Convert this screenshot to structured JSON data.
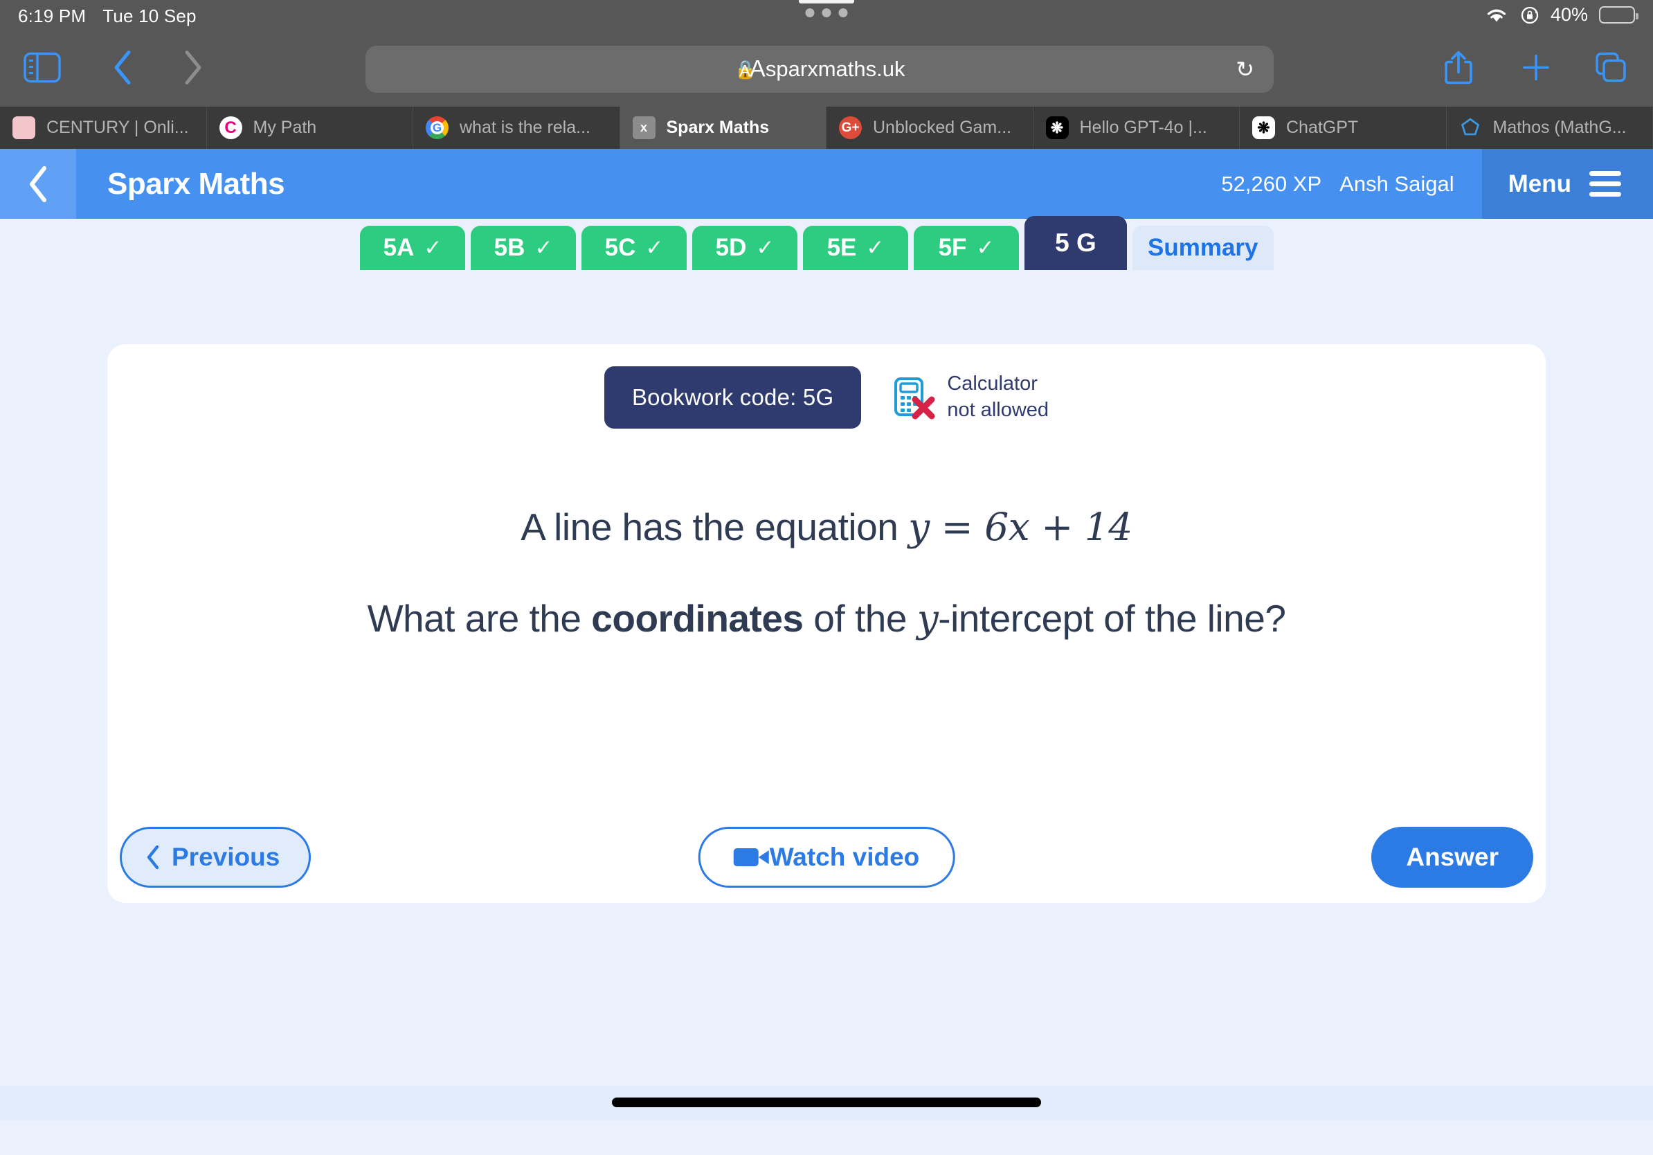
{
  "status_bar": {
    "time": "6:19 PM",
    "date": "Tue 10 Sep",
    "battery_percent": "40%",
    "wifi_icon": "wifi-icon",
    "rotation_lock_icon": "rotation-lock-icon",
    "battery_icon": "battery-icon",
    "battery_color": "#f5cf3d"
  },
  "browser": {
    "sidebar_icon": "sidebar-icon",
    "back_icon": "chevron-left-icon",
    "forward_icon": "chevron-right-icon",
    "aa_small": "A",
    "aa_large": "A",
    "lock_icon": "lock-icon",
    "url": "sparxmaths.uk",
    "reload_icon": "reload-icon",
    "share_icon": "share-icon",
    "new_tab_icon": "plus-icon",
    "tabs_overview_icon": "tabs-icon",
    "tabs": [
      {
        "label": "CENTURY | Onli...",
        "favicon": "century-favicon",
        "active": false
      },
      {
        "label": "My Path",
        "favicon": "mypath-favicon",
        "active": false
      },
      {
        "label": "what is the rela...",
        "favicon": "google-favicon",
        "active": false
      },
      {
        "label": "Sparx Maths",
        "favicon": "sparx-favicon",
        "active": true
      },
      {
        "label": "Unblocked Gam...",
        "favicon": "googleplus-favicon",
        "active": false
      },
      {
        "label": "Hello GPT-4o |...",
        "favicon": "openai-dark-favicon",
        "active": false
      },
      {
        "label": "ChatGPT",
        "favicon": "openai-light-favicon",
        "active": false
      },
      {
        "label": "Mathos (MathG...",
        "favicon": "mathos-favicon",
        "active": false
      }
    ]
  },
  "app_header": {
    "back_icon": "chevron-left-icon",
    "title": "Sparx Maths",
    "xp": "52,260 XP",
    "user": "Ansh Saigal",
    "menu_label": "Menu",
    "menu_icon": "hamburger-icon",
    "bg_color": "#4691f0"
  },
  "module_tabs": [
    {
      "label": "5A",
      "state": "complete",
      "tick": "✓"
    },
    {
      "label": "5B",
      "state": "complete",
      "tick": "✓"
    },
    {
      "label": "5C",
      "state": "complete",
      "tick": "✓"
    },
    {
      "label": "5D",
      "state": "complete",
      "tick": "✓"
    },
    {
      "label": "5E",
      "state": "complete",
      "tick": "✓"
    },
    {
      "label": "5F",
      "state": "complete",
      "tick": "✓"
    },
    {
      "label": "5 G",
      "state": "current",
      "tick": ""
    },
    {
      "label": "Summary",
      "state": "summary",
      "tick": ""
    }
  ],
  "question_card": {
    "bookwork_code": "Bookwork code: 5G",
    "calculator_icon": "calculator-not-allowed-icon",
    "calculator_line1": "Calculator",
    "calculator_line2": "not allowed",
    "question_line1_prefix": "A line has the equation ",
    "equation_y": "y",
    "equation_eq": " = ",
    "equation_rhs": "6x + 14",
    "question_line2_part1": "What are the ",
    "question_line2_bold": "coordinates",
    "question_line2_part2": " of the ",
    "question_line2_y": "y",
    "question_line2_part3": "-intercept of the line?",
    "previous_label": "Previous",
    "previous_icon": "chevron-left-icon",
    "watch_video_label": "Watch video",
    "watch_video_icon": "video-camera-icon",
    "answer_label": "Answer"
  },
  "colors": {
    "page_bg": "#eaf1fd",
    "brand_blue": "#4691f0",
    "accent_blue": "#2c7be5",
    "complete_green": "#2ecc80",
    "navy": "#2f3b6e"
  }
}
